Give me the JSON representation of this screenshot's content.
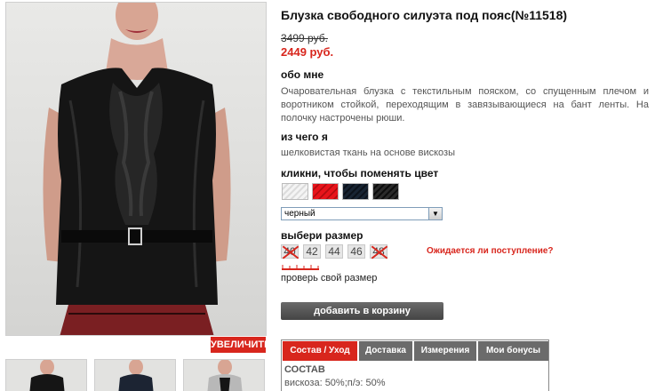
{
  "product": {
    "title": "Блузка свободного силуэта под пояс(№11518)",
    "old_price": "3499 руб.",
    "new_price": "2449 руб."
  },
  "about": {
    "heading": "обо мне",
    "text": "Очаровательная блузка с текстильным пояском, со спущенным плечом и воротником стойкой, переходящим в завязывающиеся на бант ленты. На полочку настрочены рюши."
  },
  "material": {
    "heading": "из чего я",
    "text": "шелковистая ткань на основе вискозы"
  },
  "color": {
    "heading": "кликни, чтобы поменять цвет",
    "swatches": [
      "white-swatch",
      "red-swatch",
      "navy-swatch",
      "black-swatch"
    ],
    "selected": "черный"
  },
  "size": {
    "heading": "выбери размер",
    "options": [
      {
        "label": "40",
        "available": false
      },
      {
        "label": "42",
        "available": true
      },
      {
        "label": "44",
        "available": true
      },
      {
        "label": "46",
        "available": true
      },
      {
        "label": "48",
        "available": false
      }
    ],
    "awaiting_link": "Ожидается ли поступление?",
    "check_size": "проверь свой размер"
  },
  "cart_button": "добавить в корзину",
  "zoom_button": "УВЕЛИЧИТЬ",
  "tabs": [
    {
      "label": "Состав / Уход",
      "active": true
    },
    {
      "label": "Доставка",
      "active": false
    },
    {
      "label": "Измерения",
      "active": false
    },
    {
      "label": "Мои бонусы",
      "active": false
    }
  ],
  "composition": {
    "heading": "СОСТАВ",
    "text": "вискоза: 50%;п/э: 50%"
  },
  "colors": {
    "accent_red": "#d8261d",
    "button_gray": "#555555"
  }
}
